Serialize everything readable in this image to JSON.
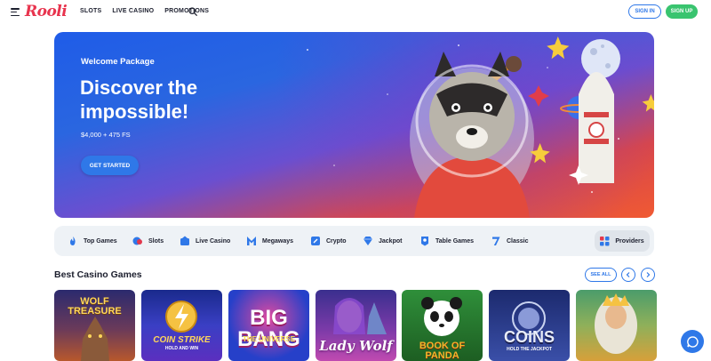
{
  "header": {
    "logo_text": "Rooli",
    "nav": [
      "SLOTS",
      "LIVE CASINO",
      "PROMOTIONS"
    ],
    "signin_label": "SIGN IN",
    "signup_label": "SIGN UP"
  },
  "hero": {
    "subtitle": "Welcome Package",
    "title": "Discover the impossible!",
    "amount": "$4,000 + 475 FS",
    "cta_label": "GET STARTED"
  },
  "categories": [
    {
      "label": "Top Games",
      "icon": "fire-icon"
    },
    {
      "label": "Slots",
      "icon": "slot-icon"
    },
    {
      "label": "Live Casino",
      "icon": "live-casino-icon"
    },
    {
      "label": "Megaways",
      "icon": "megaways-icon"
    },
    {
      "label": "Crypto",
      "icon": "crypto-icon"
    },
    {
      "label": "Jackpot",
      "icon": "diamond-icon"
    },
    {
      "label": "Table Games",
      "icon": "table-games-icon"
    },
    {
      "label": "Classic",
      "icon": "seven-icon"
    }
  ],
  "providers_label": "Providers",
  "section": {
    "title": "Best Casino Games",
    "see_all_label": "SEE ALL"
  },
  "games": [
    {
      "title": "WOLF TREASURE",
      "colors": [
        "#2b2a6e",
        "#b8582c"
      ]
    },
    {
      "title": "COIN STRIKE",
      "sub": "HOLD AND WIN",
      "colors": [
        "#1a2a8c",
        "#5b2fbf"
      ]
    },
    {
      "title": "BIG BANG",
      "sub": "THE UNIVERSE",
      "colors": [
        "#2640c9",
        "#d0388f"
      ]
    },
    {
      "title": "Lady Wolf",
      "colors": [
        "#3a2f8e",
        "#c04ab0"
      ]
    },
    {
      "title": "BOOK OF PANDA",
      "colors": [
        "#2f8f3a",
        "#1d5e22"
      ]
    },
    {
      "title": "COINS",
      "sub": "HOLD THE JACKPOT",
      "colors": [
        "#1c2a6e",
        "#3a4fa8"
      ]
    },
    {
      "title": "",
      "colors": [
        "#4b9c6b",
        "#d7a03a"
      ]
    }
  ]
}
